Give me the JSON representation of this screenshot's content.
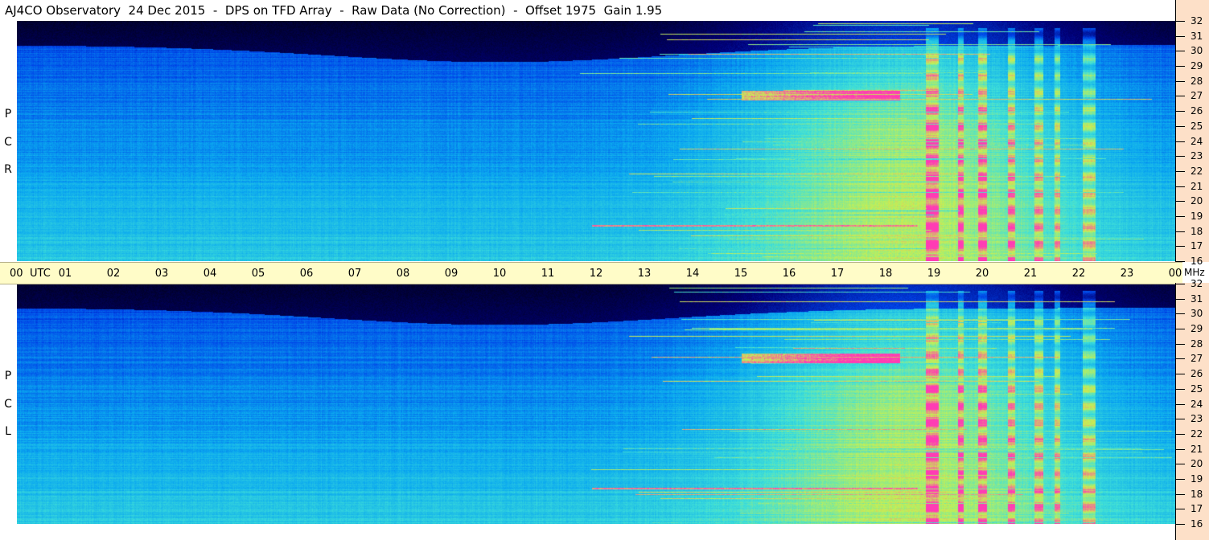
{
  "header": {
    "title": "AJ4CO Observatory  24 Dec 2015  -  DPS on TFD Array  -  Raw Data (No Correction)  -  Offset 1975  Gain 1.95"
  },
  "time_axis": {
    "utc_label": "UTC",
    "labels": [
      "00",
      "01",
      "02",
      "03",
      "04",
      "05",
      "06",
      "07",
      "08",
      "09",
      "10",
      "11",
      "12",
      "13",
      "14",
      "15",
      "16",
      "17",
      "18",
      "19",
      "20",
      "21",
      "22",
      "23",
      "00"
    ],
    "unit": "MHz"
  },
  "freq_axis": {
    "labels": [
      "32",
      "31",
      "30",
      "29",
      "28",
      "27",
      "26",
      "25",
      "24",
      "23",
      "22",
      "21",
      "20",
      "19",
      "18",
      "17",
      "16"
    ]
  },
  "panels": [
    {
      "id": "rcp",
      "letters": [
        "P",
        "C",
        "R"
      ]
    },
    {
      "id": "lcp",
      "letters": [
        "P",
        "C",
        "L"
      ]
    }
  ],
  "chart_data": {
    "type": "heatmap",
    "title": "AJ4CO Observatory  24 Dec 2015  -  DPS on TFD Array  -  Raw Data (No Correction)  -  Offset 1975  Gain 1.95",
    "x_axis": {
      "label": "UTC",
      "range": [
        0,
        24
      ],
      "ticks": [
        "00",
        "01",
        "02",
        "03",
        "04",
        "05",
        "06",
        "07",
        "08",
        "09",
        "10",
        "11",
        "12",
        "13",
        "14",
        "15",
        "16",
        "17",
        "18",
        "19",
        "20",
        "21",
        "22",
        "23",
        "00"
      ]
    },
    "y_axis": {
      "label": "MHz",
      "range": [
        16,
        32
      ],
      "ticks": [
        32,
        31,
        30,
        29,
        28,
        27,
        26,
        25,
        24,
        23,
        22,
        21,
        20,
        19,
        18,
        17,
        16
      ]
    },
    "panels": [
      "RCP",
      "LCP"
    ],
    "colormap": [
      "#000010",
      "#00007a",
      "#0044e8",
      "#0aa8f0",
      "#40e0d8",
      "#c8f050",
      "#ff3cb4"
    ]
  }
}
